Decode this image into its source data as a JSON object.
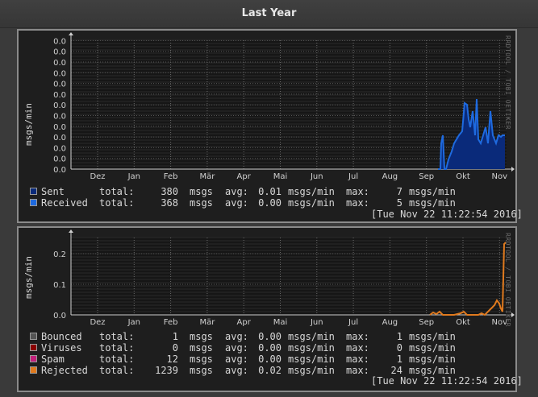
{
  "page_title": "Last Year",
  "panel1": {
    "ylabel": "msgs/min",
    "side_label": "RRDTOOL / TOBI OETIKER",
    "ytick_labels": [
      "0.0",
      "0.0",
      "0.0",
      "0.0",
      "0.0",
      "0.0",
      "0.0",
      "0.0",
      "0.0",
      "0.0",
      "0.0",
      "0.0",
      "0.0"
    ],
    "months": [
      "Dez",
      "Jan",
      "Feb",
      "Mär",
      "Apr",
      "Mai",
      "Jun",
      "Jul",
      "Aug",
      "Sep",
      "Okt",
      "Nov"
    ],
    "legend": [
      {
        "name": "Sent",
        "total": "380",
        "avg": "0.01",
        "max": "7",
        "color": "#0a2a7a",
        "unit": "msgs",
        "rate_unit": "msgs/min"
      },
      {
        "name": "Received",
        "total": "368",
        "avg": "0.00",
        "max": "5",
        "color": "#1e6adf",
        "unit": "msgs",
        "rate_unit": "msgs/min"
      }
    ],
    "timestamp": "[Tue Nov 22 11:22:54 2016]"
  },
  "panel2": {
    "ylabel": "msgs/min",
    "side_label": "RRDTOOL / TOBI OETIKER",
    "ytick_labels": [
      "0.2",
      "0.1",
      "0.0"
    ],
    "months": [
      "Dez",
      "Jan",
      "Feb",
      "Mär",
      "Apr",
      "Mai",
      "Jun",
      "Jul",
      "Aug",
      "Sep",
      "Okt",
      "Nov"
    ],
    "legend": [
      {
        "name": "Bounced",
        "total": "1",
        "avg": "0.00",
        "max": "1",
        "color": "#555555",
        "unit": "msgs",
        "rate_unit": "msgs/min"
      },
      {
        "name": "Viruses",
        "total": "0",
        "avg": "0.00",
        "max": "0",
        "color": "#8a0000",
        "unit": "msgs",
        "rate_unit": "msgs/min"
      },
      {
        "name": "Spam",
        "total": "12",
        "avg": "0.00",
        "max": "1",
        "color": "#c0207a",
        "unit": "msgs",
        "rate_unit": "msgs/min"
      },
      {
        "name": "Rejected",
        "total": "1239",
        "avg": "0.02",
        "max": "24",
        "color": "#e07a1e",
        "unit": "msgs",
        "rate_unit": "msgs/min"
      }
    ],
    "timestamp": "[Tue Nov 22 11:22:54 2016]"
  },
  "labels": {
    "total": "total:",
    "avg": "avg:",
    "max": "max:"
  },
  "chart_data": [
    {
      "type": "area",
      "ylabel": "msgs/min",
      "x": [
        "Dez",
        "Jan",
        "Feb",
        "Mär",
        "Apr",
        "Mai",
        "Jun",
        "Jul",
        "Aug",
        "Sep",
        "Okt",
        "Nov"
      ],
      "series": [
        {
          "name": "Sent",
          "color": "#0a2a7a",
          "values": [
            0,
            0,
            0,
            0,
            0,
            0,
            0,
            0,
            0,
            0.002,
            0.006,
            0.004
          ]
        },
        {
          "name": "Received",
          "color": "#1e6adf",
          "values": [
            0,
            0,
            0,
            0,
            0,
            0,
            0,
            0,
            0,
            0.002,
            0.006,
            0.004
          ]
        }
      ]
    },
    {
      "type": "line",
      "ylabel": "msgs/min",
      "ylim": [
        0,
        0.25
      ],
      "x": [
        "Dez",
        "Jan",
        "Feb",
        "Mär",
        "Apr",
        "Mai",
        "Jun",
        "Jul",
        "Aug",
        "Sep",
        "Okt",
        "Nov"
      ],
      "series": [
        {
          "name": "Bounced",
          "color": "#555555",
          "values": [
            0,
            0,
            0,
            0,
            0,
            0,
            0,
            0,
            0,
            0,
            0,
            0
          ]
        },
        {
          "name": "Viruses",
          "color": "#8a0000",
          "values": [
            0,
            0,
            0,
            0,
            0,
            0,
            0,
            0,
            0,
            0,
            0,
            0
          ]
        },
        {
          "name": "Spam",
          "color": "#c0207a",
          "values": [
            0,
            0,
            0,
            0,
            0,
            0,
            0,
            0,
            0,
            0,
            0,
            0
          ]
        },
        {
          "name": "Rejected",
          "color": "#e07a1e",
          "values": [
            0,
            0,
            0,
            0,
            0,
            0,
            0,
            0,
            0,
            0.005,
            0.01,
            0.24
          ]
        }
      ]
    }
  ]
}
